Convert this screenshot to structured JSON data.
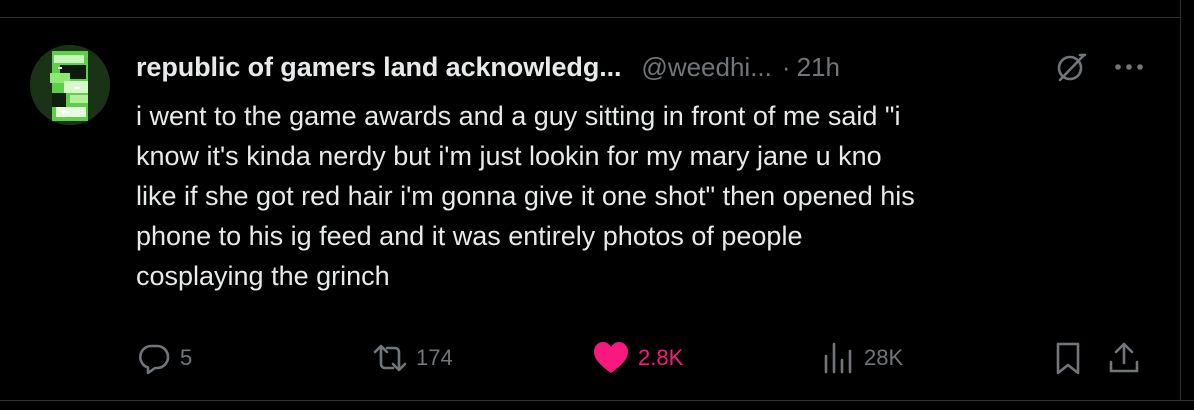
{
  "tweet": {
    "author": {
      "display_name": "republic of gamers land acknowledg...",
      "handle": "@weedhi...",
      "avatar_icon": "green-glitch-avatar"
    },
    "separator": "·",
    "timestamp": "21h",
    "header_icons": [
      "grok-icon",
      "more-icon"
    ],
    "text": "i went to the game awards and a guy sitting in front of me said \"i\nknow it's kinda nerdy but i'm just lookin for my mary jane u kno\nlike if she got red hair i'm gonna give it one shot\" then opened his\nphone to his ig feed and it was entirely photos of people\ncosplaying the grinch",
    "actions": {
      "reply": {
        "icon": "reply-icon",
        "count": "5"
      },
      "repost": {
        "icon": "repost-icon",
        "count": "174"
      },
      "like": {
        "icon": "heart-icon",
        "count": "2.8K",
        "active": true,
        "color": "#f91880"
      },
      "views": {
        "icon": "views-icon",
        "count": "28K"
      },
      "bookmark": {
        "icon": "bookmark-icon"
      },
      "share": {
        "icon": "share-icon"
      }
    }
  },
  "colors": {
    "background": "#000000",
    "text_primary": "#e7e9ea",
    "text_secondary": "#71767b",
    "like_active": "#f91880",
    "border": "#2f3336"
  }
}
